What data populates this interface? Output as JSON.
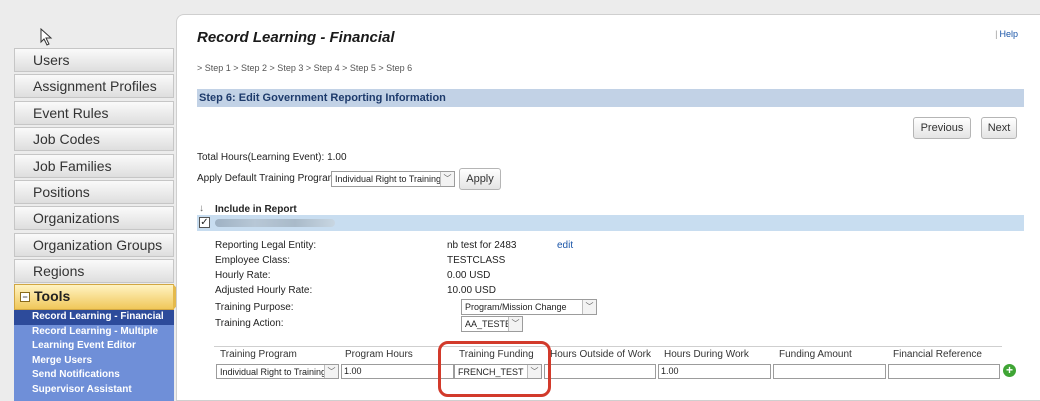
{
  "sidebar": {
    "items": [
      {
        "label": "Users"
      },
      {
        "label": "Assignment Profiles"
      },
      {
        "label": "Event Rules"
      },
      {
        "label": "Job Codes"
      },
      {
        "label": "Job Families"
      },
      {
        "label": "Positions"
      },
      {
        "label": "Organizations"
      },
      {
        "label": "Organization Groups"
      },
      {
        "label": "Regions"
      }
    ],
    "tools_label": "Tools",
    "tools_items": [
      {
        "label": "Record Learning - Financial",
        "active": true
      },
      {
        "label": "Record Learning - Multiple"
      },
      {
        "label": "Learning Event Editor"
      },
      {
        "label": "Merge Users"
      },
      {
        "label": "Send Notifications"
      },
      {
        "label": "Supervisor Assistant"
      }
    ]
  },
  "header": {
    "title": "Record Learning - Financial",
    "help": "Help",
    "steps": "> Step 1 > Step 2 > Step 3 > Step 4 > Step 5 > Step 6",
    "step_title": "Step 6: Edit Government Reporting Information"
  },
  "buttons": {
    "previous": "Previous",
    "next": "Next",
    "apply": "Apply"
  },
  "summary": {
    "total_hours": "Total Hours(Learning Event): 1.00",
    "apply_default_label": "Apply Default Training Program:",
    "apply_default_value": "Individual Right to Training",
    "include_label": "Include in Report"
  },
  "details": {
    "reporting_legal_entity_label": "Reporting Legal Entity:",
    "reporting_legal_entity_value": "nb test for 2483",
    "edit_link": "edit",
    "employee_class_label": "Employee Class:",
    "employee_class_value": "TESTCLASS",
    "hourly_rate_label": "Hourly Rate:",
    "hourly_rate_value": "0.00 USD",
    "adjusted_hourly_rate_label": "Adjusted Hourly Rate:",
    "adjusted_hourly_rate_value": "10.00 USD",
    "training_purpose_label": "Training Purpose:",
    "training_purpose_value": "Program/Mission Change",
    "training_action_label": "Training Action:",
    "training_action_value": "AA_TESTE"
  },
  "grid": {
    "headers": {
      "training_program": "Training Program",
      "program_hours": "Program Hours",
      "training_funding": "Training Funding",
      "hours_outside": "Hours Outside of Work",
      "hours_during": "Hours During Work",
      "funding_amount": "Funding Amount",
      "financial_reference": "Financial Reference"
    },
    "row": {
      "training_program": "Individual Right to Training",
      "program_hours": "1.00",
      "training_funding": "FRENCH_TEST",
      "hours_outside": "",
      "hours_during": "1.00",
      "funding_amount": "",
      "financial_reference": ""
    }
  },
  "colors": {
    "step_header_bg": "#c2d2e6",
    "tools_bg": "#f0c75a",
    "submenu_bg": "#6f8fd8",
    "highlight": "#d23a2b",
    "add_icon": "#3fa535"
  }
}
